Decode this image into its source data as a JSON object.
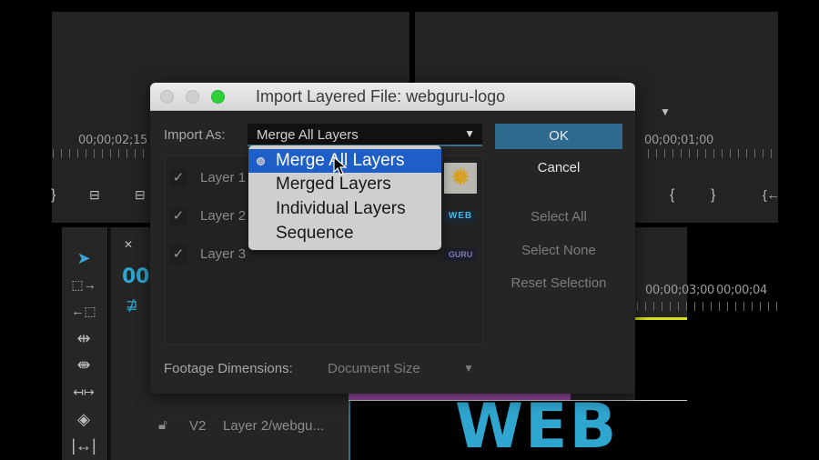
{
  "dialog": {
    "title": "Import Layered File: webguru-logo",
    "import_as": {
      "label": "Import As:",
      "value": "Merge All Layers",
      "options": [
        "Merge All Layers",
        "Merged Layers",
        "Individual Layers",
        "Sequence"
      ],
      "selected_index": 0
    },
    "layers": [
      {
        "name": "Layer 1",
        "checked": true,
        "thumb": "sun-logo"
      },
      {
        "name": "Layer 2",
        "checked": true,
        "thumb": "WEB"
      },
      {
        "name": "Layer 3",
        "checked": true,
        "thumb": "GURU"
      }
    ],
    "footage_dimensions": {
      "label": "Footage Dimensions:",
      "value": "Document Size"
    },
    "buttons": {
      "ok": "OK",
      "cancel": "Cancel",
      "select_all": "Select All",
      "select_none": "Select None",
      "reset_selection": "Reset Selection"
    }
  },
  "background": {
    "source_timecode": "00;00;02;15",
    "program_timecode": "00;00;01;00",
    "timeline_timecode_a": "00;00;03;00",
    "timeline_timecode_b": "00;00;04",
    "timeline_current": "00;",
    "track": {
      "name": "V2",
      "clip": "Layer 2/webgu..."
    },
    "preview_text": "WEB"
  },
  "colors": {
    "accent_blue": "#2e6a8d",
    "menu_highlight": "#1e5fc7",
    "timecode_blue": "#2fa6cf",
    "clip_purple": "#9a4da5",
    "playhead_yellow": "#d4e21a"
  }
}
